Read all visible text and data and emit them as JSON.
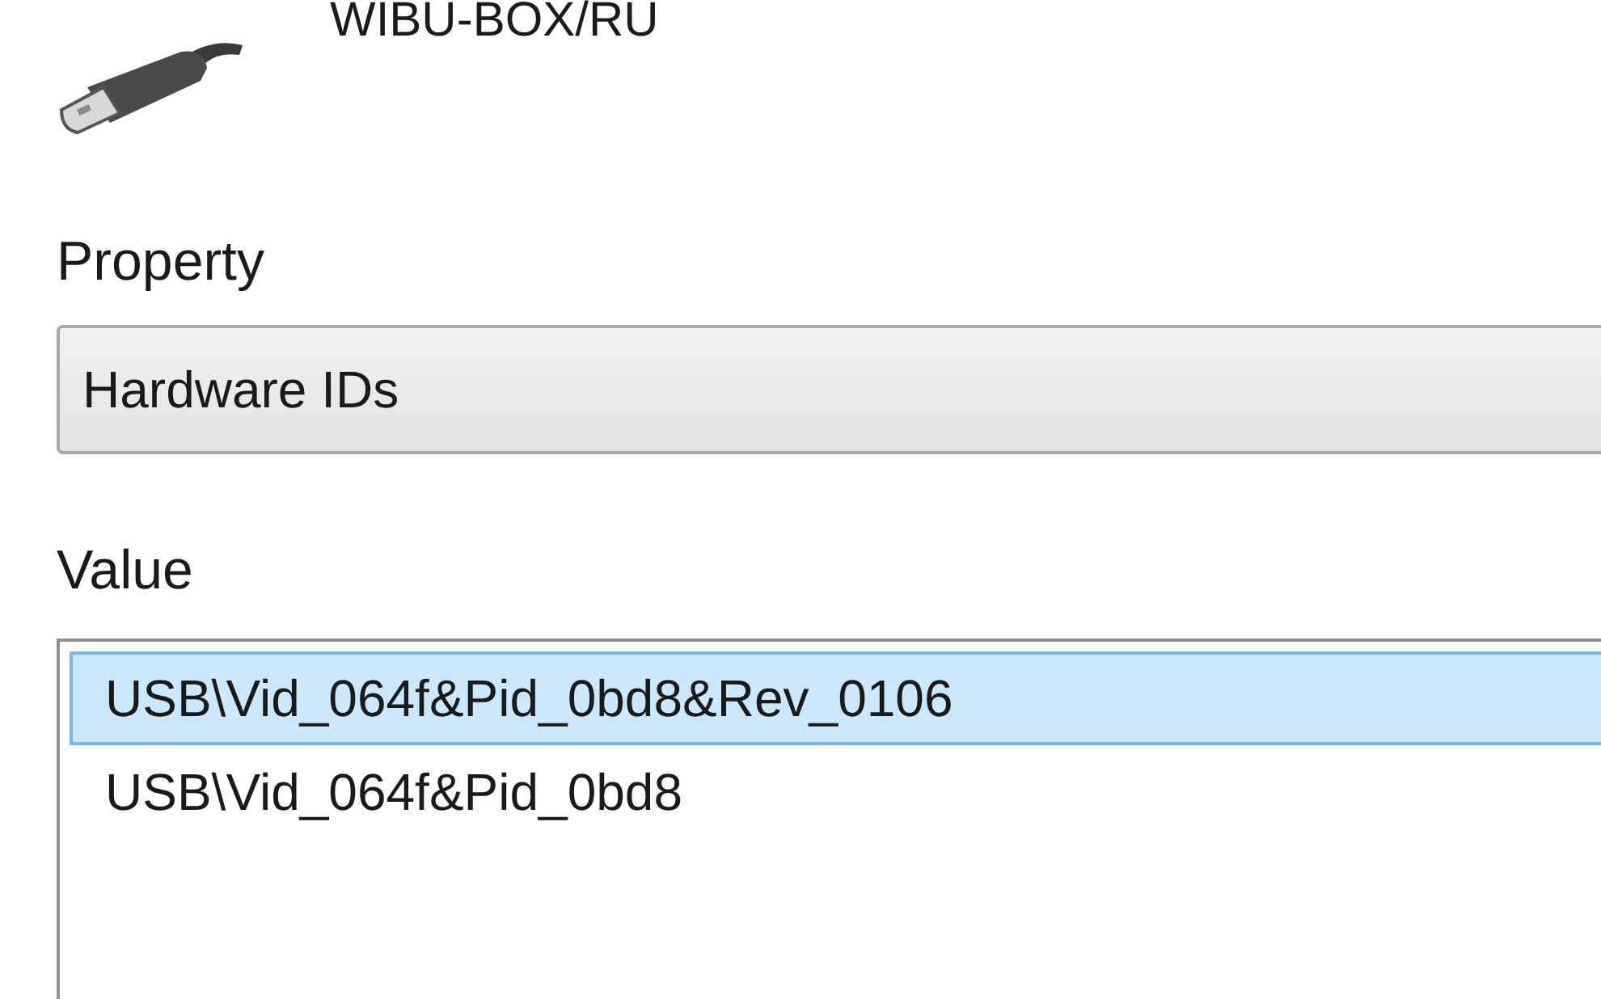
{
  "device": {
    "title": "WIBU-BOX/RU"
  },
  "property": {
    "label": "Property",
    "value": "Hardware IDs"
  },
  "value": {
    "label": "Value",
    "items": [
      {
        "text": "USB\\Vid_064f&Pid_0bd8&Rev_0106",
        "selected": true
      },
      {
        "text": "USB\\Vid_064f&Pid_0bd8",
        "selected": false
      }
    ]
  }
}
